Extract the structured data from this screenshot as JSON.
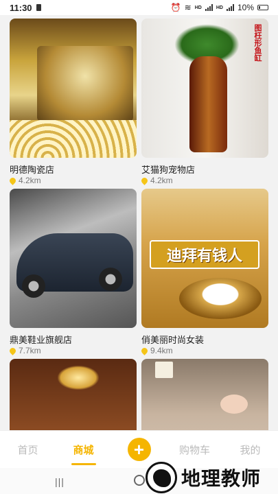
{
  "status": {
    "time": "11:30",
    "hd1": "HD",
    "hd2": "HD",
    "battery": "10%"
  },
  "shops": [
    {
      "name": "明德陶瓷店",
      "distance": "4.2km"
    },
    {
      "name": "艾猫狗宠物店",
      "distance": "4.2km"
    },
    {
      "name": "鼎美鞋业旗舰店",
      "distance": "7.7km"
    },
    {
      "name": "俏美丽时尚女装",
      "distance": "9.4km"
    },
    {
      "name": "",
      "distance": ""
    },
    {
      "name": "",
      "distance": ""
    }
  ],
  "image_text": {
    "vase_side": "图枉形鱼缸",
    "toilet_banner": "迪拜有钱人"
  },
  "tabs": [
    {
      "label": "首页"
    },
    {
      "label": "商城"
    },
    {
      "label": "+"
    },
    {
      "label": "购物车"
    },
    {
      "label": "我的"
    }
  ],
  "watermark": {
    "text": "地理教师"
  },
  "colors": {
    "accent": "#f5b500",
    "pin": "#f5c518"
  }
}
